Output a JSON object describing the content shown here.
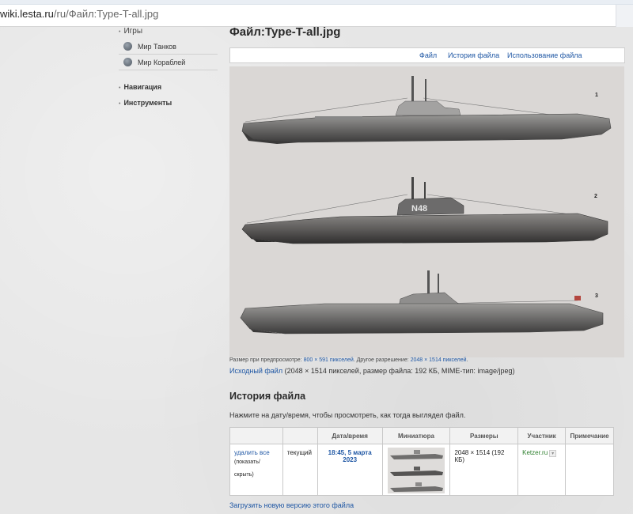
{
  "browser": {
    "url_host": "wiki.lesta.ru",
    "url_path": "/ru/Файл:Type-T-all.jpg"
  },
  "sidebar": {
    "games_header": "Игры",
    "games": [
      {
        "label": "Мир Танков",
        "icon": "wot-logo-icon"
      },
      {
        "label": "Мир Кораблей",
        "icon": "wows-logo-icon"
      }
    ],
    "sections": [
      {
        "label": "Навигация"
      },
      {
        "label": "Инструменты"
      }
    ]
  },
  "page": {
    "title": "Файл:Type-T-all.jpg",
    "tabs": [
      "Файл",
      "История файла",
      "Использование файла"
    ]
  },
  "image": {
    "labels": [
      "1",
      "2",
      "3"
    ],
    "hull_number": "N48"
  },
  "file_info": {
    "size_prefix": "Размер при предпросмотре:",
    "preview_size": "800 × 591 пикселей",
    "other_prefix": ". Другое разрешение:",
    "other_size": "2048 × 1514 пикселей",
    "other_suffix": ".",
    "orig_link": "Исходный файл",
    "orig_details": " (2048 × 1514 пикселей, размер файла: 192 КБ, MIME-тип: image/jpeg)"
  },
  "history": {
    "title": "История файла",
    "hint": "Нажмите на дату/время, чтобы просмотреть, как тогда выглядел файл.",
    "columns": [
      "",
      "",
      "Дата/время",
      "Миниатюра",
      "Размеры",
      "Участник",
      "Примечание"
    ],
    "row": {
      "delete": "удалить все",
      "toggle": "(показать/скрыть)",
      "status": "текущий",
      "datetime": "18:45, 5 марта 2023",
      "dimensions": "2048 × 1514 (192 КБ)",
      "user": "Ketzer.ru",
      "note": ""
    },
    "upload_link": "Загрузить новую версию этого файла"
  }
}
